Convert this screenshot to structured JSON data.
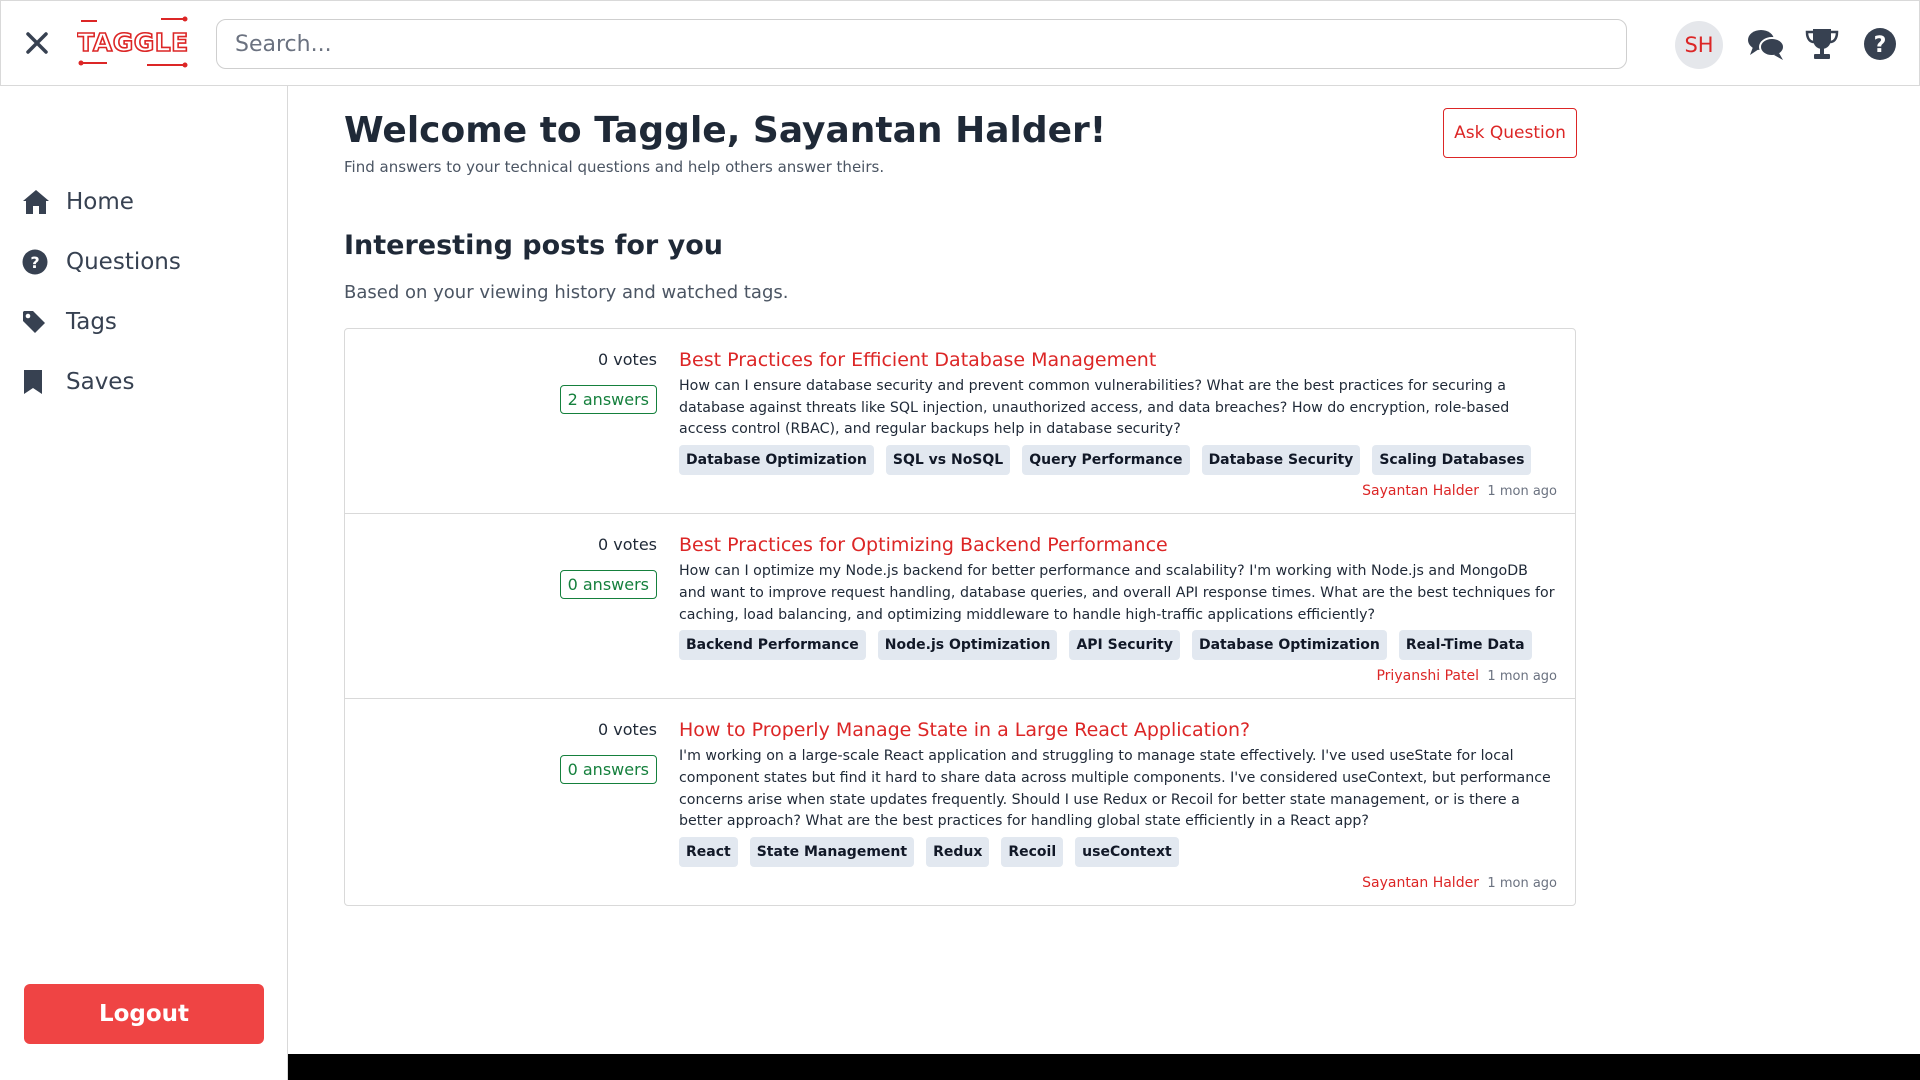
{
  "header": {
    "logo_text": "TAGGLE",
    "search_placeholder": "Search...",
    "avatar_initials": "SH"
  },
  "sidebar": {
    "items": [
      {
        "label": "Home",
        "icon": "home-icon"
      },
      {
        "label": "Questions",
        "icon": "question-circle-icon"
      },
      {
        "label": "Tags",
        "icon": "tag-icon"
      },
      {
        "label": "Saves",
        "icon": "bookmark-icon"
      }
    ],
    "logout_label": "Logout"
  },
  "main": {
    "welcome": "Welcome to Taggle, Sayantan Halder!",
    "subtitle": "Find answers to your technical questions and help others answer theirs.",
    "ask_label": "Ask Question",
    "section_title": "Interesting posts for you",
    "section_sub": "Based on your viewing history and watched tags."
  },
  "posts": [
    {
      "votes": "0 votes",
      "answers": "2 answers",
      "title": "Best Practices for Efficient Database Management",
      "excerpt": "How can I ensure database security and prevent common vulnerabilities? What are the best practices for securing a database against threats like SQL injection, unauthorized access, and data breaches? How do encryption, role-based access control (RBAC), and regular backups help in database security?",
      "tags": [
        "Database Optimization",
        "SQL vs NoSQL",
        "Query Performance",
        "Database Security",
        "Scaling Databases"
      ],
      "author": "Sayantan Halder",
      "time": "1 mon ago"
    },
    {
      "votes": "0 votes",
      "answers": "0 answers",
      "title": "Best Practices for Optimizing Backend Performance",
      "excerpt": "How can I optimize my Node.js backend for better performance and scalability? I'm working with Node.js and MongoDB and want to improve request handling, database queries, and overall API response times. What are the best techniques for caching, load balancing, and optimizing middleware to handle high-traffic applications efficiently?",
      "tags": [
        "Backend Performance",
        "Node.js Optimization",
        "API Security",
        "Database Optimization",
        "Real-Time Data"
      ],
      "author": "Priyanshi Patel",
      "time": "1 mon ago"
    },
    {
      "votes": "0 votes",
      "answers": "0 answers",
      "title": "How to Properly Manage State in a Large React Application?",
      "excerpt": "I'm working on a large-scale React application and struggling to manage state effectively. I've used useState for local component states but find it hard to share data across multiple components. I've considered useContext, but performance concerns arise when state updates frequently. Should I use Redux or Recoil for better state management, or is there a better approach? What are the best practices for handling global state efficiently in a React app?",
      "tags": [
        "React",
        "State Management",
        "Redux",
        "Recoil",
        "useContext"
      ],
      "author": "Sayantan Halder",
      "time": "1 mon ago"
    }
  ],
  "colors": {
    "brand": "#dc2626",
    "logout": "#ef4444",
    "answers_green": "#15803d",
    "tag_bg": "#e2e8f0"
  }
}
